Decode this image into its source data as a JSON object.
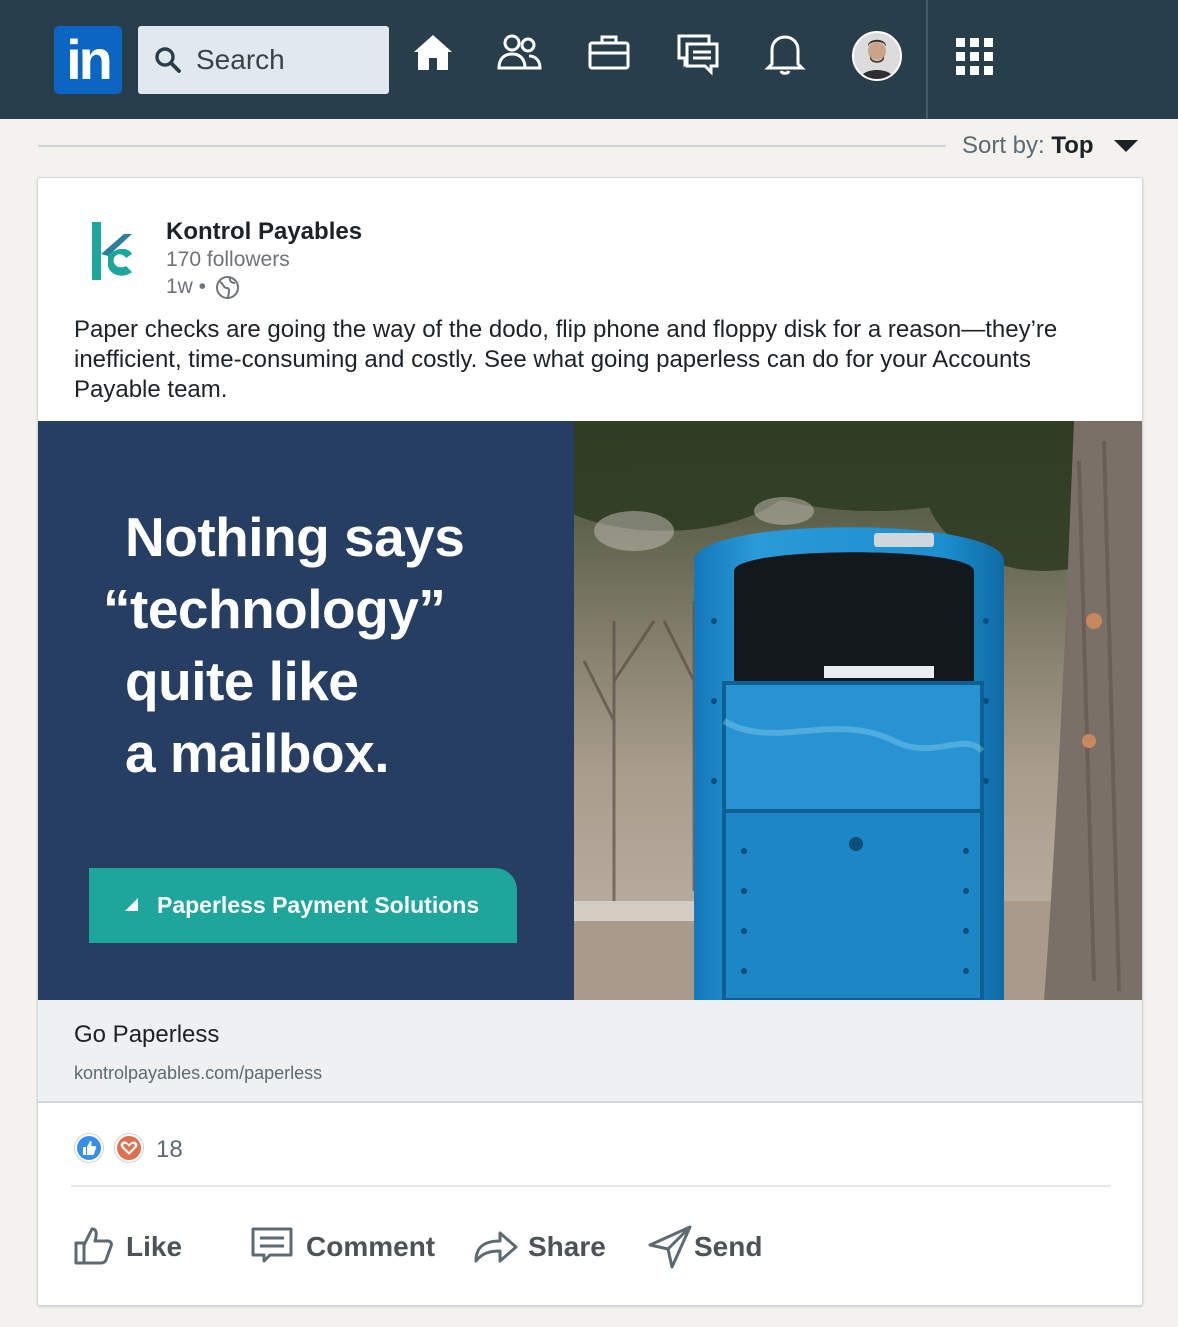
{
  "nav": {
    "logo_text": "in",
    "search_placeholder": "Search",
    "icons": [
      "home-icon",
      "my-network-icon",
      "jobs-icon",
      "messaging-icon",
      "notifications-icon",
      "profile-avatar",
      "apps-grid-icon"
    ],
    "bar_color": "#283e4a"
  },
  "sort": {
    "label": "Sort by:",
    "value": "Top"
  },
  "post": {
    "company_name": "Kontrol Payables",
    "followers": "170 followers",
    "time": "1w •",
    "text": "Paper checks are going the way of the dodo, flip phone and floppy disk for a reason—they’re inefficient, time-consuming and costly. See what going paperless can do for your Accounts Payable team.",
    "ad": {
      "headline_lines": [
        "Nothing says",
        "“technology”",
        "quite like",
        "a mailbox."
      ],
      "cta_label": "Paperless Payment Solutions",
      "bg_color": "#273e63",
      "cta_color": "#1ea59c"
    },
    "link": {
      "title": "Go Paperless",
      "url": "kontrolpayables.com/paperless"
    },
    "reactions": {
      "count": "18",
      "types": [
        "like-reaction-icon",
        "love-reaction-icon"
      ]
    },
    "actions": {
      "like": "Like",
      "comment": "Comment",
      "share": "Share",
      "send": "Send"
    }
  }
}
